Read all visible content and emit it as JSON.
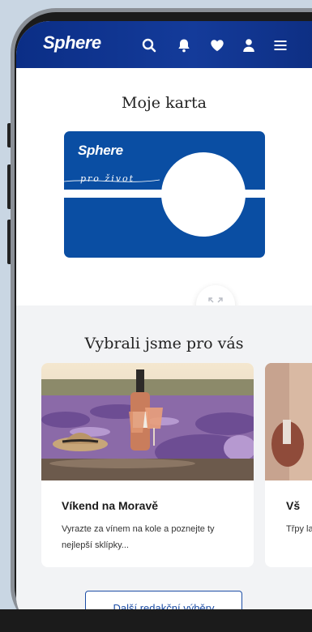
{
  "header": {
    "logo": "Sphere",
    "icons": [
      "search-icon",
      "bell-icon",
      "heart-icon",
      "user-icon",
      "menu-icon"
    ],
    "background": "#0b2e86"
  },
  "card_section": {
    "title": "Moje karta",
    "card": {
      "logo": "Sphere",
      "tagline": "pro  život",
      "color": "#0a4ea3"
    },
    "expand_icon": "expand-icon"
  },
  "selections": {
    "title": "Vybrali jsme pro vás",
    "tiles": [
      {
        "title": "Víkend na Moravě",
        "description": "Vyrazte za vínem na kole a poznejte ty nejlepší sklípky..."
      },
      {
        "title": "Vš",
        "description": "Třpy laho"
      }
    ],
    "more_button": "Další redakční výběry"
  },
  "colors": {
    "accent": "#1d4ea6",
    "section_bg": "#f2f3f5"
  }
}
